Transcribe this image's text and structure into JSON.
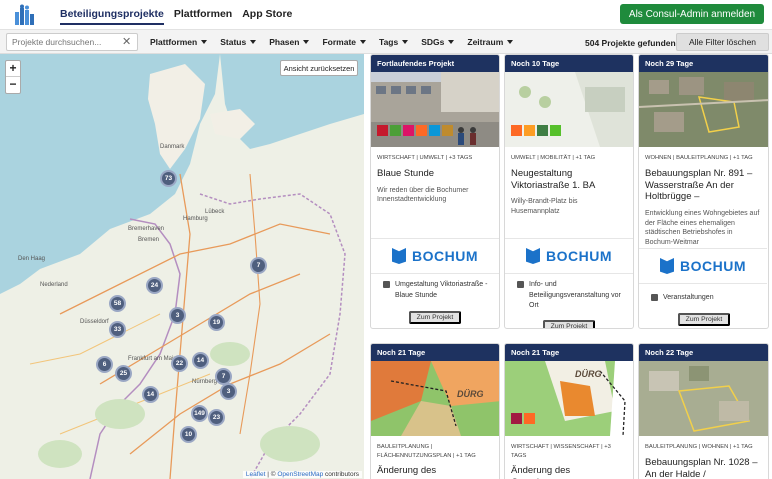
{
  "nav": {
    "items": [
      {
        "label": "Beteiligungsprojekte",
        "active": true
      },
      {
        "label": "Plattformen",
        "active": false
      },
      {
        "label": "App Store",
        "active": false
      }
    ],
    "admin_button": "Als Consul-Admin anmelden"
  },
  "filterbar": {
    "search_placeholder": "Projekte durchsuchen...",
    "filters": [
      "Plattformen",
      "Status",
      "Phasen",
      "Formate",
      "Tags",
      "SDGs",
      "Zeitraum"
    ],
    "count": "504 Projekte gefunden",
    "clear_button": "Alle Filter löschen"
  },
  "map": {
    "zoom_in": "+",
    "zoom_out": "−",
    "reset_view": "Ansicht zurücksetzen",
    "attribution_leaflet": "Leaflet",
    "attribution_sep": " | © ",
    "attribution_osm": "OpenStreetMap",
    "attribution_rest": " contributors",
    "clusters": [
      "73",
      "7",
      "24",
      "58",
      "3",
      "19",
      "33",
      "6",
      "25",
      "22",
      "14",
      "7",
      "3",
      "14",
      "149",
      "23",
      "10"
    ],
    "labels": [
      "Danmark",
      "Hamburg",
      "Bremen",
      "Den Haag",
      "Nederland",
      "Düsseldorf",
      "Frankfurt am Main",
      "Nürnberg",
      "Lübeck",
      "Bremerhaven"
    ]
  },
  "cards": [
    {
      "head": "Fortlaufendes Projekt",
      "tags": "WIRTSCHAFT | UMWELT | +3 TAGS",
      "title": "Blaue Stunde",
      "desc": "Wir reden über die Bochumer Innenstadtentwicklung",
      "logo": "BOCHUM",
      "info": "Umgestaltung Viktoriastraße - Blaue Stunde",
      "button": "Zum Projekt"
    },
    {
      "head": "Noch 10 Tage",
      "tags": "UMWELT | MOBILITÄT | +1 TAG",
      "title": "Neugestaltung Viktoriastraße 1. BA",
      "desc": "Willy-Brandt-Platz bis Husemannplatz",
      "logo": "BOCHUM",
      "info": "Info- und Beteiligungsveranstaltung vor Ort",
      "button": "Zum Projekt"
    },
    {
      "head": "Noch 29 Tage",
      "tags": "WOHNEN | BAULEITPLANUNG | +1 TAG",
      "title": "Bebauungsplan Nr. 891 – Wasserstraße An der Holtbrügge –",
      "desc": "Entwicklung eines Wohngebietes auf der Fläche eines ehemaligen städtischen Betriebshofes in Bochum-Weitmar",
      "logo": "BOCHUM",
      "info": "Veranstaltungen",
      "button": "Zum Projekt"
    },
    {
      "head": "Noch 21 Tage",
      "tags": "BAULEITPLANUNG | FLÄCHENNUTZUNGSPLAN | +1 TAG",
      "title": "Änderung des",
      "img_label": "DÜRG"
    },
    {
      "head": "Noch 21 Tage",
      "tags": "WIRTSCHAFT | WISSENSCHAFT | +3 TAGS",
      "title": "Änderung des Gemeinsamen",
      "img_label": "DÜRG"
    },
    {
      "head": "Noch 22 Tage",
      "tags": "BAULEITPLANUNG | WOHNEN | +1 TAG",
      "title": "Bebauungsplan Nr. 1028 – An der Halde /"
    }
  ],
  "colors": {
    "brand_navy": "#1e3260",
    "admin_green": "#1f8b3c",
    "bochum_blue": "#1b72c9",
    "cluster": "#4f5f7e"
  }
}
